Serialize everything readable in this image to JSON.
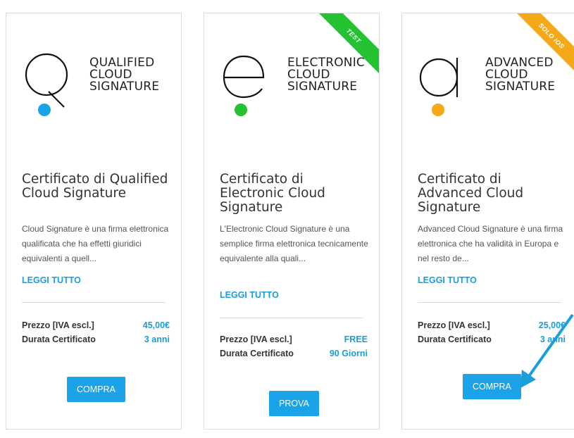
{
  "colors": {
    "accent": "#1a9ddb",
    "button": "#1aa3e8",
    "dot_blue": "#1aa3e8",
    "dot_green": "#22c231",
    "dot_orange": "#f5a818",
    "ribbon_test": "#22c231",
    "ribbon_ios": "#f5a818"
  },
  "cards": [
    {
      "logo_icon": "q-letter-icon",
      "brand": [
        "QUALIFIED",
        "CLOUD",
        "SIGNATURE"
      ],
      "title": "Certificato di Qualified Cloud Signature",
      "description": "Cloud Signature è una firma elettronica qualificata che ha effetti giuridici equivalenti a quell...",
      "read_more": "LEGGI TUTTO",
      "price_label": "Prezzo [IVA escl.]",
      "price_value": "45,00€",
      "duration_label": "Durata Certificato",
      "duration_value": "3 anni",
      "button": "COMPRA"
    },
    {
      "ribbon": "TEST",
      "logo_icon": "e-letter-icon",
      "brand": [
        "ELECTRONIC",
        "CLOUD",
        "SIGNATURE"
      ],
      "title": "Certificato di Electronic Cloud Signature",
      "description": "L'Electronic Cloud Signature è una semplice firma elettronica tecnicamente equivalente alla quali...",
      "read_more": "LEGGI TUTTO",
      "price_label": "Prezzo [IVA escl.]",
      "price_value": "FREE",
      "duration_label": "Durata Certificato",
      "duration_value": "90 Giorni",
      "button": "PROVA"
    },
    {
      "ribbon": "SOLO IOS",
      "logo_icon": "a-letter-icon",
      "brand": [
        "ADVANCED",
        "CLOUD",
        "SIGNATURE"
      ],
      "title": "Certificato di Advanced Cloud Signature",
      "description": "Advanced Cloud Signature è una firma elettronica che ha validità in Europa e nel resto de...",
      "read_more": "LEGGI TUTTO",
      "price_label": "Prezzo [IVA escl.]",
      "price_value": "25,00€",
      "duration_label": "Durata Certificato",
      "duration_value": "3 anni",
      "button": "COMPRA"
    }
  ],
  "annotation_icon": "arrow-pointer-icon"
}
